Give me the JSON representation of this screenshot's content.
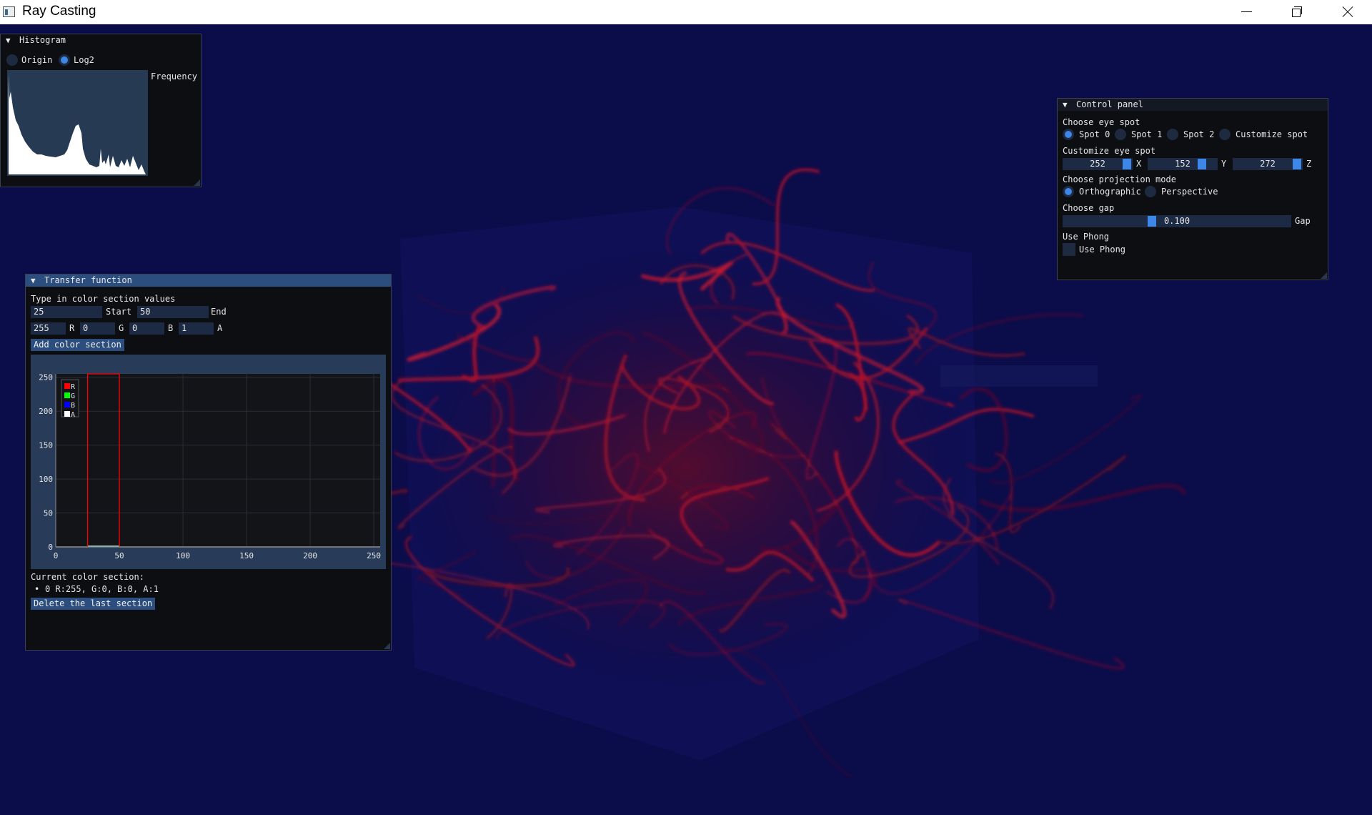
{
  "window": {
    "title": "Ray Casting",
    "icon": "app-icon"
  },
  "histogram": {
    "title": "Histogram",
    "modes": [
      {
        "label": "Origin",
        "selected": false
      },
      {
        "label": "Log2",
        "selected": true
      }
    ],
    "plot_label": "Frequency"
  },
  "transfer": {
    "title": "Transfer function",
    "prompt": "Type in color section values",
    "start": {
      "value": "25",
      "label": "Start"
    },
    "end": {
      "value": "50",
      "label": "End"
    },
    "r": {
      "value": "255",
      "label": "R"
    },
    "g": {
      "value": "0",
      "label": "G"
    },
    "b": {
      "value": "0",
      "label": "B"
    },
    "a": {
      "value": "1",
      "label": "A"
    },
    "add_button": "Add color section",
    "current_label": "Current color section:",
    "sections": [
      {
        "bullet": "•",
        "text": "0  R:255, G:0, B:0, A:1"
      }
    ],
    "delete_button": "Delete the last section",
    "color_red": "#ff0000"
  },
  "control": {
    "title": "Control panel",
    "eye_label": "Choose eye spot",
    "eye_options": [
      {
        "label": "Spot 0",
        "selected": true
      },
      {
        "label": "Spot 1",
        "selected": false
      },
      {
        "label": "Spot 2",
        "selected": false
      },
      {
        "label": "Customize spot",
        "selected": false
      }
    ],
    "customize_label": "Customize eye spot",
    "coords": [
      {
        "value": "252",
        "axis": "X"
      },
      {
        "value": "152",
        "axis": "Y"
      },
      {
        "value": "272",
        "axis": "Z"
      }
    ],
    "projection_label": "Choose projection mode",
    "projection_options": [
      {
        "label": "Orthographic",
        "selected": true
      },
      {
        "label": "Perspective",
        "selected": false
      }
    ],
    "gap_label": "Choose gap",
    "gap_value": "0.100",
    "gap_fraction": 0.385,
    "gap_axis": "Gap",
    "phong_label": "Use Phong",
    "phong_checkbox_label": "Use Phong",
    "phong_checked": false
  },
  "chart_data": {
    "type": "area",
    "title": "",
    "xlabel": "",
    "ylabel": "",
    "x": [
      0,
      25,
      25,
      50,
      50,
      255
    ],
    "xlim": [
      0,
      255
    ],
    "ylim": [
      0,
      255
    ],
    "xticks": [
      "0",
      "50",
      "100",
      "150",
      "200",
      "250"
    ],
    "yticks": [
      "0",
      "50",
      "100",
      "150",
      "200",
      "250"
    ],
    "series": [
      {
        "name": "R",
        "color": "#ff0000",
        "values": [
          0,
          0,
          255,
          255,
          0,
          0
        ]
      },
      {
        "name": "G",
        "color": "#00ff00",
        "values": [
          0,
          0,
          0,
          0,
          0,
          0
        ]
      },
      {
        "name": "B",
        "color": "#0000ff",
        "values": [
          0,
          0,
          0,
          0,
          0,
          0
        ]
      },
      {
        "name": "A",
        "color": "#ffffff",
        "values": [
          0,
          0,
          1,
          1,
          0,
          0
        ]
      }
    ],
    "legend": "top-left",
    "grid": true
  }
}
